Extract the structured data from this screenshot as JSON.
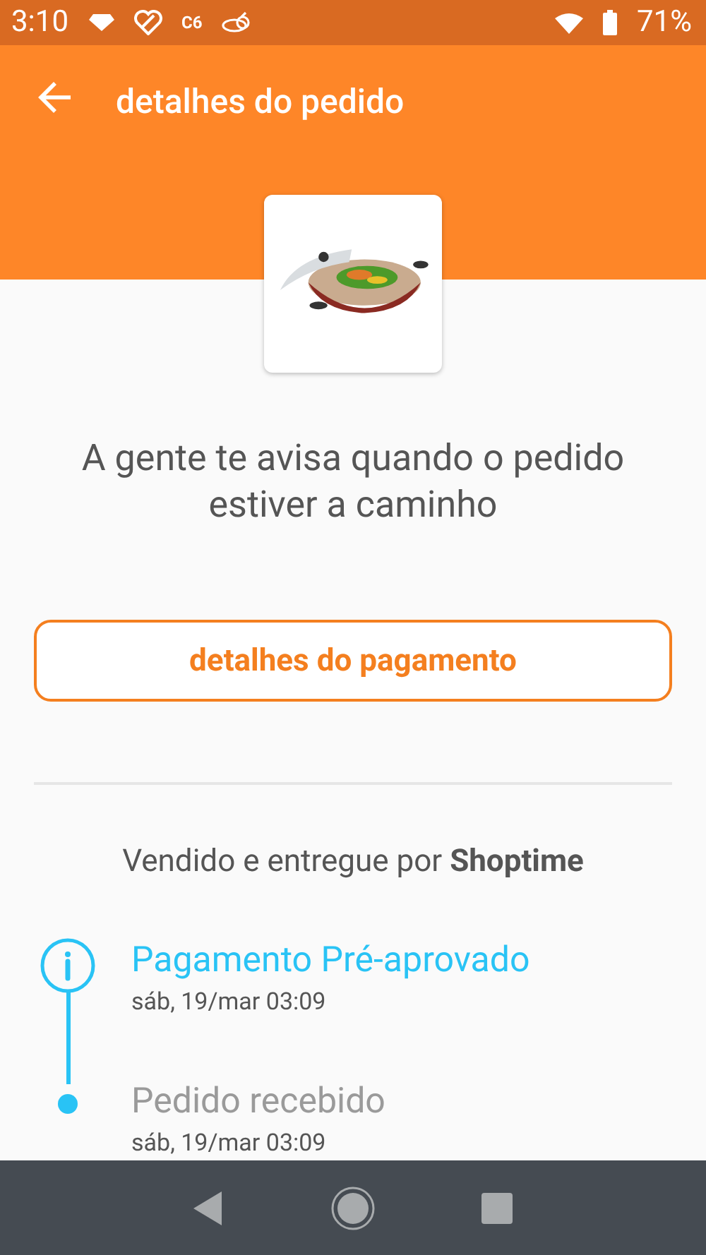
{
  "status_bar": {
    "time": "3:10",
    "app_badge": "C6",
    "battery": "71%"
  },
  "header": {
    "title": "detalhes do pedido"
  },
  "message": "A gente te avisa quando o pedido estiver a caminho",
  "payment_button": "detalhes do pagamento",
  "seller": "Vendido e entregue por **Shoptime**",
  "timeline": [
    {
      "title": "Pagamento Pré-aprovado",
      "date": "sáb, 19/mar 03:09",
      "current": true
    },
    {
      "title": "Pedido recebido",
      "date": "sáb, 19/mar 03:09",
      "current": false
    }
  ]
}
